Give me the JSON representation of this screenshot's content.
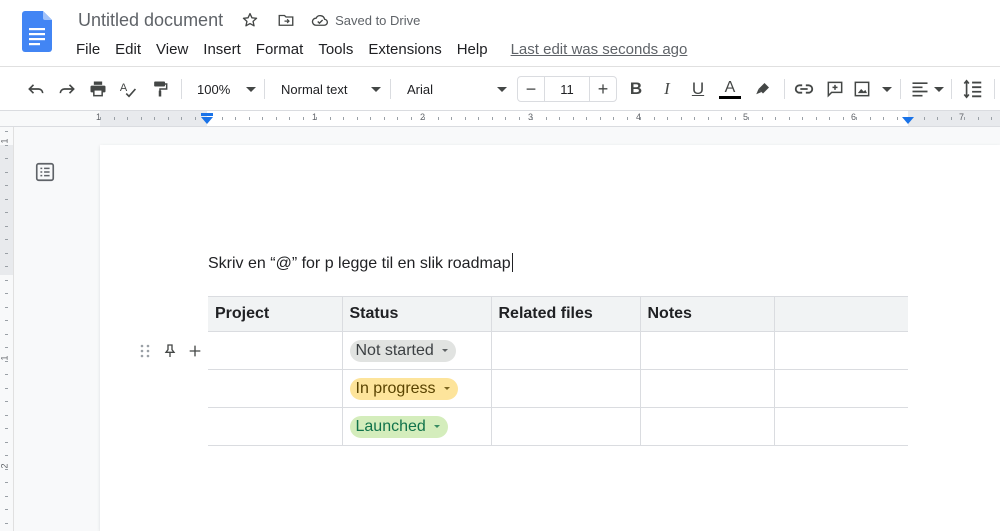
{
  "header": {
    "doc_title": "Untitled document",
    "saved_status": "Saved to Drive",
    "menu": [
      "File",
      "Edit",
      "View",
      "Insert",
      "Format",
      "Tools",
      "Extensions",
      "Help"
    ],
    "last_edit": "Last edit was seconds ago"
  },
  "toolbar": {
    "zoom": "100%",
    "style": "Normal text",
    "font": "Arial",
    "font_size": "11",
    "minus": "−",
    "plus": "+",
    "bold": "B",
    "italic": "I",
    "underline": "U",
    "text_color_letter": "A"
  },
  "ruler": {
    "numbers": [
      "1",
      "1",
      "2",
      "3",
      "4",
      "5",
      "6",
      "7"
    ],
    "v_numbers": [
      "1",
      "1",
      "2"
    ]
  },
  "document": {
    "body_text": "Skriv en “@” for p legge til en slik roadmap"
  },
  "table": {
    "headers": [
      "Project",
      "Status",
      "Related files",
      "Notes",
      ""
    ],
    "rows": [
      {
        "project": "",
        "status": "Not started",
        "files": "",
        "notes": "",
        "extra": ""
      },
      {
        "project": "",
        "status": "In progress",
        "files": "",
        "notes": "",
        "extra": ""
      },
      {
        "project": "",
        "status": "Launched",
        "files": "",
        "notes": "",
        "extra": ""
      }
    ]
  },
  "colors": {
    "doc_blue": "#4285f4",
    "accent": "#1a73e8",
    "chip_not_started_bg": "#e1e3e1",
    "chip_not_started_fg": "#3c4043",
    "chip_in_progress_bg": "#fde49b",
    "chip_in_progress_fg": "#594300",
    "chip_launched_bg": "#d4edbc",
    "chip_launched_fg": "#11734b"
  },
  "icons": {
    "title_row": [
      "star-icon",
      "move-to-folder-icon",
      "cloud-done-icon"
    ],
    "toolbar": [
      "undo-icon",
      "redo-icon",
      "print-icon",
      "spellcheck-icon",
      "paint-format-icon",
      "highlighter-icon",
      "link-icon",
      "comment-icon",
      "image-icon",
      "align-icon",
      "line-spacing-icon"
    ],
    "side": [
      "outline-icon",
      "drag-handle-icon",
      "pin-icon",
      "add-row-icon"
    ]
  }
}
